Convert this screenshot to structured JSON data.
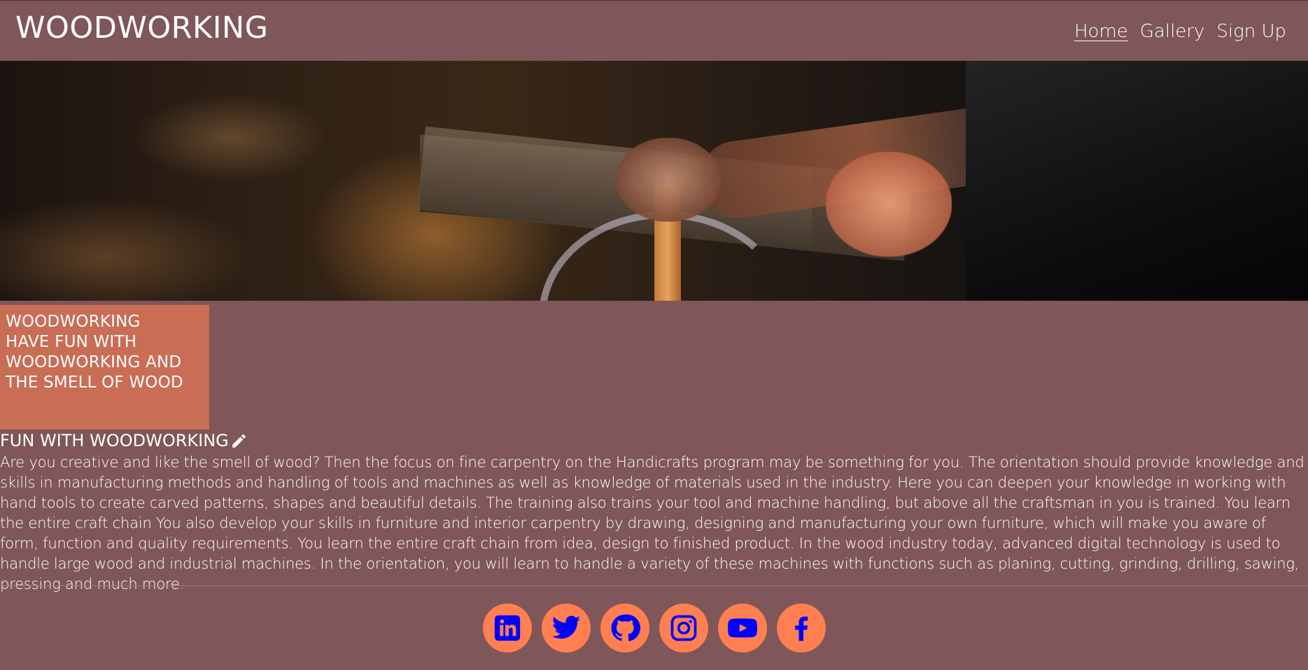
{
  "header": {
    "logo": "WOODWORKING",
    "nav": [
      {
        "label": "Home",
        "active": true
      },
      {
        "label": "Gallery",
        "active": false
      },
      {
        "label": "Sign Up",
        "active": false
      }
    ]
  },
  "tagline": {
    "lines": [
      "WOODWORKING",
      "HAVE FUN WITH",
      "WOODWORKING AND",
      "THE SMELL OF WOOD"
    ]
  },
  "article": {
    "title": "FUN WITH WOODWORKING",
    "title_icon": "pencil-icon",
    "body": "Are you creative and like the smell of wood? Then the focus on fine carpentry on the Handicrafts program may be something for you. The orientation should provide knowledge and skills in manufacturing methods and handling of tools and machines as well as knowledge of materials used in the industry. Here you can deepen your knowledge in working with hand tools to create carved patterns, shapes and beautiful details. The training also trains your tool and machine handling, but above all the craftsman in you is trained. You learn the entire craft chain You also develop your skills in furniture and interior carpentry by drawing, designing and manufacturing your own furniture, which will make you aware of form, function and quality requirements. You learn the entire craft chain from idea, design to finished product. In the wood industry today, advanced digital technology is used to handle large wood and industrial machines. In the orientation, you will learn to handle a variety of these machines with functions such as planing, cutting, grinding, drilling, sawing, pressing and much more."
  },
  "footer": {
    "social": [
      {
        "name": "linkedin-icon"
      },
      {
        "name": "twitter-icon"
      },
      {
        "name": "github-icon"
      },
      {
        "name": "instagram-icon"
      },
      {
        "name": "youtube-icon"
      },
      {
        "name": "facebook-icon"
      }
    ]
  },
  "colors": {
    "background": "#7f5659",
    "tagline_box": "#c96d55",
    "social_circle": "#ff7f50",
    "social_glyph": "#0000ff"
  }
}
